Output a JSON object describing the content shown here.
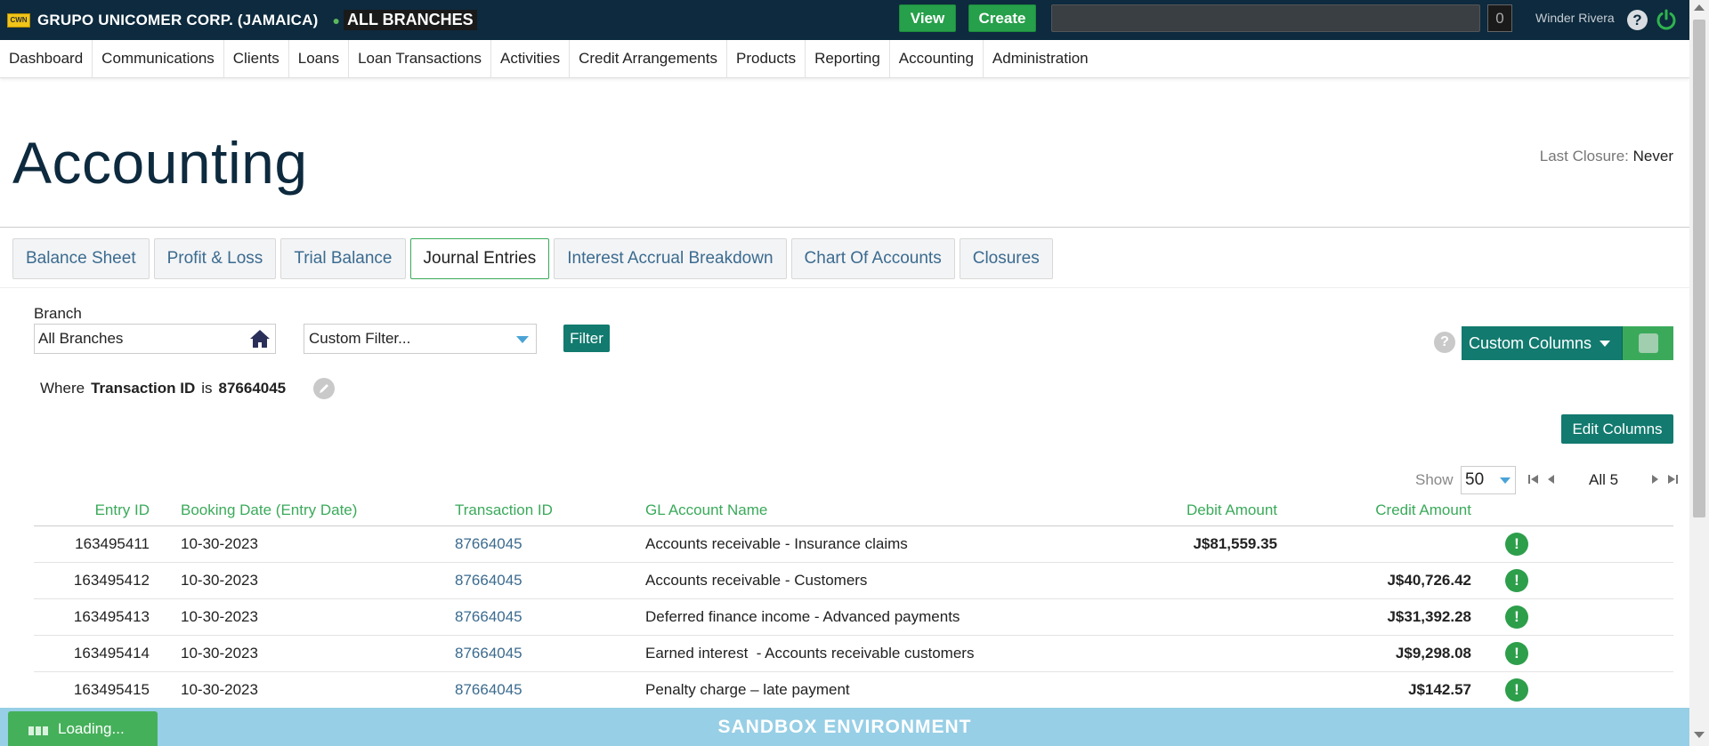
{
  "topbar": {
    "company": "GRUPO UNICOMER CORP. (JAMAICA)",
    "branch": "ALL BRANCHES",
    "view_label": "View",
    "create_label": "Create",
    "search_value": "",
    "count": "0",
    "user": "Winder Rivera",
    "help": "?",
    "logo_text": "CWN"
  },
  "nav": [
    "Dashboard",
    "Communications",
    "Clients",
    "Loans",
    "Loan Transactions",
    "Activities",
    "Credit Arrangements",
    "Products",
    "Reporting",
    "Accounting",
    "Administration"
  ],
  "header": {
    "title": "Accounting",
    "last_closure_label": "Last Closure:",
    "last_closure_value": "Never"
  },
  "tabs": [
    {
      "label": "Balance Sheet",
      "active": false
    },
    {
      "label": "Profit & Loss",
      "active": false
    },
    {
      "label": "Trial Balance",
      "active": false
    },
    {
      "label": "Journal Entries",
      "active": true
    },
    {
      "label": "Interest Accrual Breakdown",
      "active": false
    },
    {
      "label": "Chart Of Accounts",
      "active": false
    },
    {
      "label": "Closures",
      "active": false
    }
  ],
  "filters": {
    "branch_label": "Branch",
    "branch_value": "All Branches",
    "custom_filter": "Custom Filter...",
    "filter_button": "Filter",
    "where": "Where",
    "field": "Transaction ID",
    "operator": "is",
    "value": "87664045",
    "help": "?"
  },
  "actions": {
    "custom_columns": "Custom Columns",
    "edit_columns": "Edit Columns"
  },
  "pager": {
    "show_label": "Show",
    "page_size": "50",
    "summary": "All 5"
  },
  "table": {
    "headers": [
      "Entry ID",
      "Booking Date (Entry Date)",
      "Transaction ID",
      "GL Account Name",
      "Debit Amount",
      "Credit Amount"
    ],
    "rows": [
      {
        "entry_id": "163495411",
        "date": "10-30-2023",
        "txn": "87664045",
        "gl": "Accounts receivable - Insurance claims",
        "debit": "J$81,559.35",
        "credit": ""
      },
      {
        "entry_id": "163495412",
        "date": "10-30-2023",
        "txn": "87664045",
        "gl": "Accounts receivable - Customers",
        "debit": "",
        "credit": "J$40,726.42"
      },
      {
        "entry_id": "163495413",
        "date": "10-30-2023",
        "txn": "87664045",
        "gl": "Deferred finance income - Advanced payments",
        "debit": "",
        "credit": "J$31,392.28"
      },
      {
        "entry_id": "163495414",
        "date": "10-30-2023",
        "txn": "87664045",
        "gl": "Earned interest  - Accounts receivable customers",
        "debit": "",
        "credit": "J$9,298.08"
      },
      {
        "entry_id": "163495415",
        "date": "10-30-2023",
        "txn": "87664045",
        "gl": "Penalty charge – late payment",
        "debit": "",
        "credit": "J$142.57"
      }
    ],
    "status_glyph": "!"
  },
  "footer": {
    "sandbox": "SANDBOX ENVIRONMENT",
    "loading": "Loading..."
  },
  "colors": {
    "topbar": "#0d2a3e",
    "accent_green": "#3aaa5a",
    "teal": "#127a6f",
    "sandbox": "#97cfe6"
  }
}
